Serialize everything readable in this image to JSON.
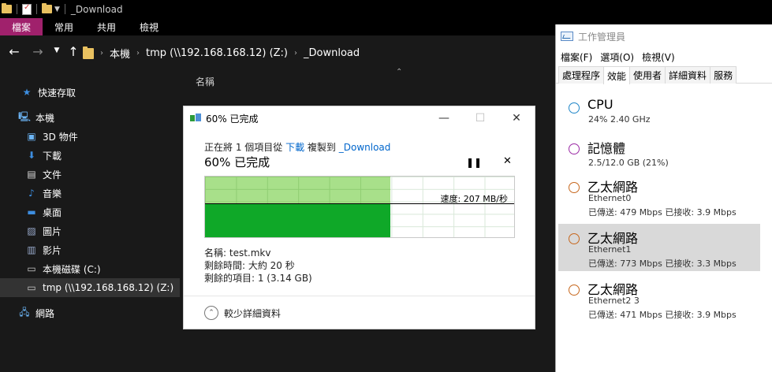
{
  "explorer": {
    "title": "_Download",
    "ribbon_tabs": [
      "檔案",
      "常用",
      "共用",
      "檢視"
    ],
    "breadcrumb": [
      "本機",
      "tmp (\\\\192.168.168.12) (Z:)",
      "_Download"
    ],
    "sidebar": {
      "quick_access": "快速存取",
      "this_pc": "本機",
      "items": [
        "3D 物件",
        "下載",
        "文件",
        "音樂",
        "桌面",
        "圖片",
        "影片",
        "本機磁碟 (C:)",
        "tmp (\\\\192.168.168.12) (Z:)"
      ],
      "network": "網路"
    },
    "column_name": "名稱"
  },
  "copy_dialog": {
    "title": "60% 已完成",
    "line1_prefix": "正在將 1 個項目從 ",
    "source_link": "下載",
    "line1_mid": " 複製到 ",
    "dest_link": "_Download",
    "percent_text": "60% 已完成",
    "progress": 0.6,
    "speed_label": "速度: 207 MB/秒",
    "speed_level": 0.56,
    "name_line": "名稱: test.mkv",
    "time_line": "剩餘時間: 大約 20 秒",
    "items_line": "剩餘的項目: 1 (3.14 GB)",
    "less_details": "較少詳細資料",
    "colors": {
      "fill": "#0fa828",
      "bg": "#a8e08a",
      "link": "#0066cc"
    }
  },
  "task_manager": {
    "title": "工作管理員",
    "menu": [
      "檔案(F)",
      "選項(O)",
      "檢視(V)"
    ],
    "tabs": [
      "處理程序",
      "效能",
      "使用者",
      "詳細資料",
      "服務"
    ],
    "items": [
      {
        "name": "CPU",
        "sub1": "24%  2.40 GHz",
        "sub2": "",
        "color": "#1f86c8"
      },
      {
        "name": "記憶體",
        "sub1": "2.5/12.0 GB (21%)",
        "sub2": "",
        "color": "#9b2aa5"
      },
      {
        "name": "乙太網路",
        "sub1": "Ethernet0",
        "sub2": "已傳送: 479 Mbps 已接收: 3.9 Mbps",
        "color": "#c7671d"
      },
      {
        "name": "乙太網路",
        "sub1": "Ethernet1",
        "sub2": "已傳送: 773 Mbps 已接收: 3.3 Mbps",
        "color": "#c7671d"
      },
      {
        "name": "乙太網路",
        "sub1": "Ethernet2 3",
        "sub2": "已傳送: 471 Mbps 已接收: 3.9 Mbps",
        "color": "#c7671d"
      }
    ]
  }
}
